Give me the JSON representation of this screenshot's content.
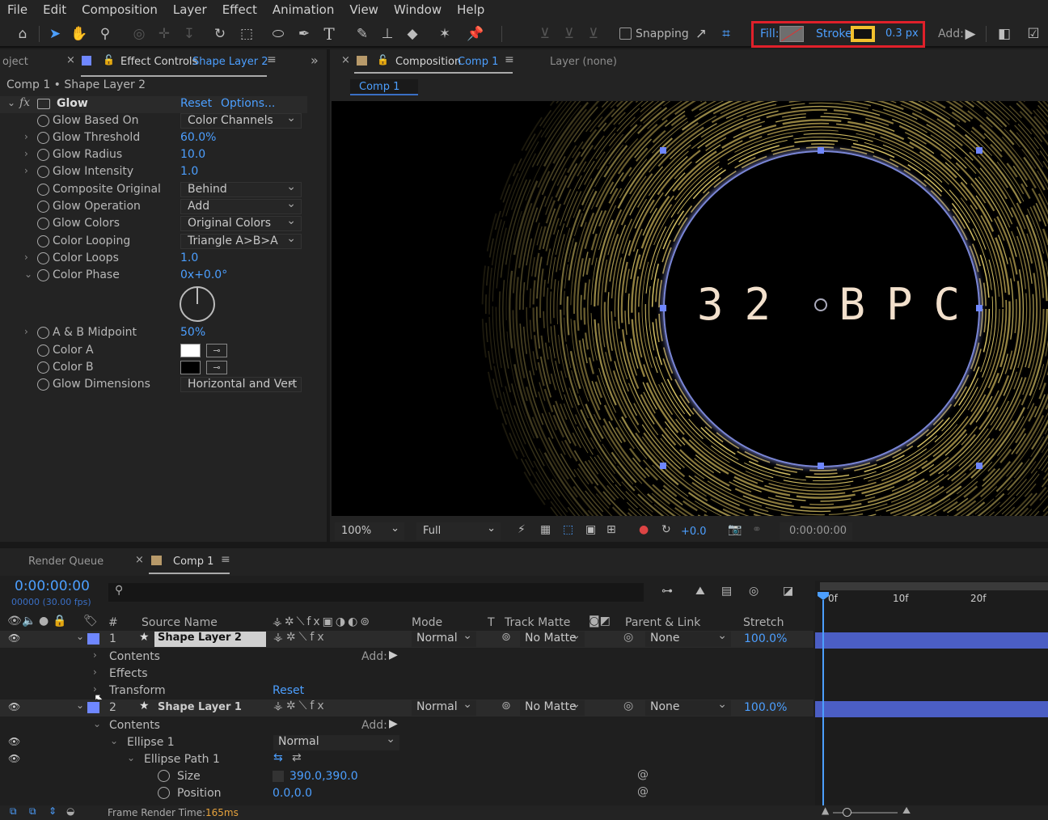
{
  "menu": [
    "File",
    "Edit",
    "Composition",
    "Layer",
    "Effect",
    "Animation",
    "View",
    "Window",
    "Help"
  ],
  "toolbar": {
    "snapping_label": "Snapping",
    "fill_label": "Fill:",
    "stroke_label": "Stroke:",
    "stroke_width": "0.3 px",
    "add_label": "Add:",
    "fill_color": "#6e6e6e",
    "stroke_color": "#f2c12e"
  },
  "left_panel": {
    "project_tab": "oject",
    "effect_controls_tab": "Effect Controls",
    "effect_controls_layer": "Shape Layer 2",
    "breadcrumb": "Comp 1 • Shape Layer 2",
    "effect_name": "Glow",
    "reset": "Reset",
    "options": "Options...",
    "properties": [
      {
        "name": "Glow Based On",
        "value": "Color Channels",
        "kind": "dropdown"
      },
      {
        "name": "Glow Threshold",
        "value": "60.0%",
        "kind": "value"
      },
      {
        "name": "Glow Radius",
        "value": "10.0",
        "kind": "value"
      },
      {
        "name": "Glow Intensity",
        "value": "1.0",
        "kind": "value"
      },
      {
        "name": "Composite Original",
        "value": "Behind",
        "kind": "dropdown"
      },
      {
        "name": "Glow Operation",
        "value": "Add",
        "kind": "dropdown"
      },
      {
        "name": "Glow Colors",
        "value": "Original Colors",
        "kind": "dropdown"
      },
      {
        "name": "Color Looping",
        "value": "Triangle A>B>A",
        "kind": "dropdown"
      },
      {
        "name": "Color Loops",
        "value": "1.0",
        "kind": "value"
      },
      {
        "name": "Color Phase",
        "value": "0x+0.0°",
        "kind": "value"
      },
      {
        "name": "A & B Midpoint",
        "value": "50%",
        "kind": "value"
      },
      {
        "name": "Color A",
        "value": "",
        "kind": "color",
        "color": "#ffffff"
      },
      {
        "name": "Color B",
        "value": "",
        "kind": "color",
        "color": "#000000"
      },
      {
        "name": "Glow Dimensions",
        "value": "Horizontal and Vert",
        "kind": "dropdown"
      }
    ]
  },
  "comp_panel": {
    "tab_label": "Composition",
    "tab_comp": "Comp 1",
    "layer_tab": "Layer (none)",
    "subtab": "Comp 1",
    "canvas_text": "32 BPC",
    "zoom": "100%",
    "resolution": "Full",
    "exposure": "+0.0",
    "timecode": "0:00:00:00"
  },
  "timeline": {
    "render_queue": "Render Queue",
    "comp_tab": "Comp 1",
    "timecode": "0:00:00:00",
    "frames_info": "00000 (30.00 fps)",
    "search_placeholder": "",
    "columns": {
      "hash": "#",
      "source": "Source Name",
      "mode": "Mode",
      "t": "T",
      "track_matte": "Track Matte",
      "parent": "Parent & Link",
      "stretch": "Stretch"
    },
    "ruler": [
      "0f",
      "10f",
      "20f"
    ],
    "layers": [
      {
        "num": "1",
        "name": "Shape Layer 2",
        "mode": "Normal",
        "matte": "No Matte",
        "parent": "None",
        "stretch": "100.0%"
      },
      {
        "num": "2",
        "name": "Shape Layer 1",
        "mode": "Normal",
        "matte": "No Matte",
        "parent": "None",
        "stretch": "100.0%"
      }
    ],
    "sub": {
      "contents": "Contents",
      "effects": "Effects",
      "transform": "Transform",
      "reset": "Reset",
      "add": "Add:",
      "contents2": "Contents",
      "ellipse": "Ellipse 1",
      "ellipse_mode": "Normal",
      "ellipse_path": "Ellipse Path 1",
      "size_label": "Size",
      "size_value": "390.0,390.0",
      "position_label": "Position",
      "position_value": "0.0,0.0"
    },
    "footer": {
      "label": "Frame Render Time:",
      "value": "165ms"
    }
  },
  "colors": {
    "accent": "#4c9fff",
    "layer_label": "#6f87ff",
    "highlight_box": "#e0202a",
    "ring_gold": "#c9b25a"
  }
}
